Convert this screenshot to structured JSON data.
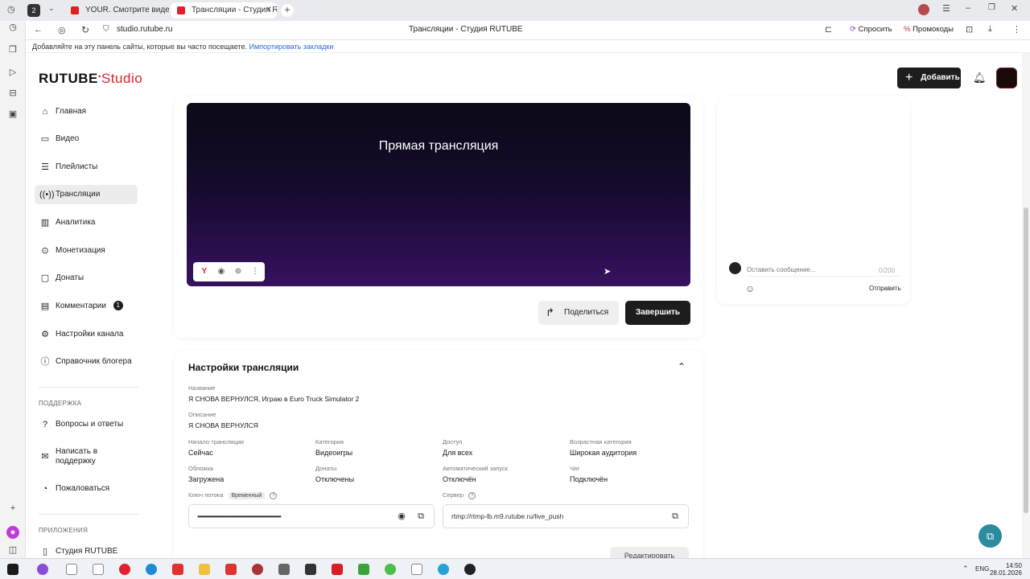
{
  "browser": {
    "tabs": [
      {
        "label": "YOUR. Смотрите видео о"
      },
      {
        "label": "Трансляции - Студия R"
      }
    ],
    "tab_count_badge": "2",
    "url": "studio.rutube.ru",
    "page_title": "Трансляции - Студия RUTUBE",
    "ask_label": "Спросить",
    "promo_label": "Промокоды",
    "bookmarks_text": "Добавляйте на эту панель сайты, которые вы часто посещаете.",
    "bookmarks_link": "Импортировать закладки"
  },
  "header": {
    "logo_main": "RUTUBE",
    "logo_sub": "Studio",
    "add_label": "Добавить"
  },
  "sidebar": {
    "items": [
      {
        "label": "Главная",
        "icon": "home-icon"
      },
      {
        "label": "Видео",
        "icon": "video-icon"
      },
      {
        "label": "Плейлисты",
        "icon": "playlist-icon"
      },
      {
        "label": "Трансляции",
        "icon": "broadcast-icon"
      },
      {
        "label": "Аналитика",
        "icon": "analytics-icon"
      },
      {
        "label": "Монетизация",
        "icon": "monetization-icon"
      },
      {
        "label": "Донаты",
        "icon": "donate-icon"
      },
      {
        "label": "Комментарии",
        "icon": "comment-icon",
        "badge": "1"
      },
      {
        "label": "Настройки канала",
        "icon": "gear-icon"
      },
      {
        "label": "Справочник блогера",
        "icon": "info-icon"
      }
    ],
    "support_heading": "ПОДДЕРЖКА",
    "support_items": [
      {
        "label": "Вопросы и ответы"
      },
      {
        "label": "Написать в поддержку"
      },
      {
        "label": "Пожаловаться"
      }
    ],
    "apps_heading": "ПРИЛОЖЕНИЯ",
    "apps_items": [
      {
        "label": "Студия RUTUBE"
      }
    ]
  },
  "player": {
    "title": "Прямая трансляция",
    "share_label": "Поделиться",
    "finish_label": "Завершить"
  },
  "chat": {
    "placeholder": "Оставить сообщение...",
    "counter": "0/200",
    "send_label": "Отправить"
  },
  "settings": {
    "title": "Настройки трансляции",
    "name_label": "Название",
    "name_value": "Я СНОВА ВЕРНУЛСЯ, Играю в Euro Truck Simulator 2",
    "desc_label": "Описание",
    "desc_value": "Я СНОВА ВЕРНУЛСЯ",
    "grid": [
      {
        "label": "Начало трансляции",
        "value": "Сейчас"
      },
      {
        "label": "Категория",
        "value": "Видеоигры"
      },
      {
        "label": "Доступ",
        "value": "Для всех"
      },
      {
        "label": "Возрастная категория",
        "value": "Широкая аудитория"
      },
      {
        "label": "Обложка",
        "value": "Загружена"
      },
      {
        "label": "Донаты",
        "value": "Отключены"
      },
      {
        "label": "Автоматический запуск",
        "value": "Отключён"
      },
      {
        "label": "Чат",
        "value": "Подключён"
      }
    ],
    "key_label": "Ключ потока",
    "key_badge": "Временный",
    "key_value": "••••••••••••••••••••••••••••••••••••••••••••••••••••••••••••••••••••••",
    "server_label": "Сервер",
    "server_value": "rtmp://rtmp-lb.m9.rutube.ru/live_push",
    "edit_label": "Редактировать"
  },
  "taskbar": {
    "lang": "ENG",
    "time": "14:50",
    "date": "28.01.2026"
  },
  "colors": {
    "accent_red": "#e0212c",
    "dark_button": "#1d1d1d",
    "help_teal": "#2a8c9c"
  }
}
